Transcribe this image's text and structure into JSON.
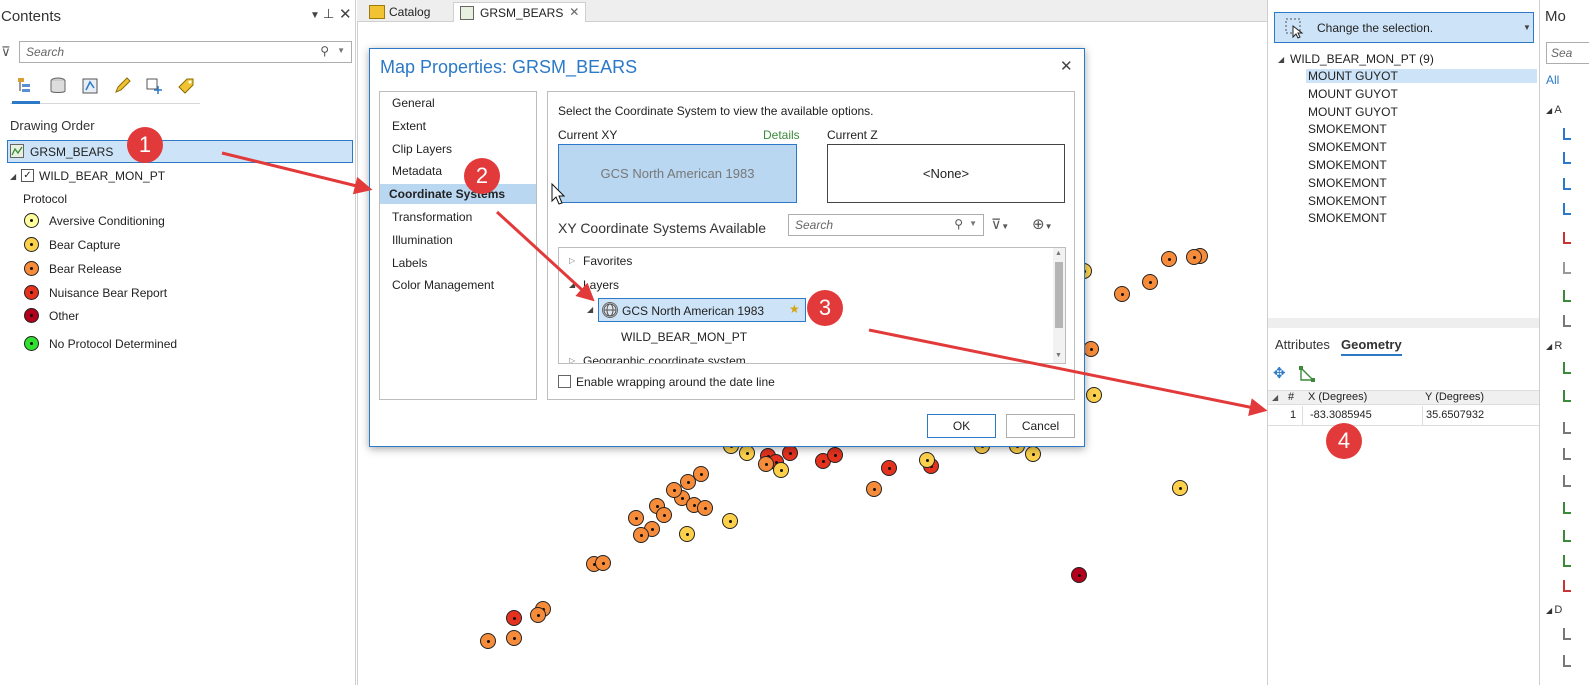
{
  "contents": {
    "title": "Contents",
    "search_placeholder": "Search",
    "section": "Drawing Order",
    "map_layer": "GRSM_BEARS",
    "feature_layer": "WILD_BEAR_MON_PT",
    "legend_heading": "Protocol",
    "legend": [
      {
        "label": "Aversive Conditioning",
        "color": "#ffff9e"
      },
      {
        "label": "Bear Capture",
        "color": "#fdd04c"
      },
      {
        "label": "Bear Release",
        "color": "#f68b3a"
      },
      {
        "label": "Nuisance Bear Report",
        "color": "#e5321e"
      },
      {
        "label": "Other",
        "color": "#b3001b"
      },
      {
        "label": "No Protocol Determined",
        "color": "#2fe02f"
      }
    ]
  },
  "tabs": {
    "catalog": "Catalog",
    "map": "GRSM_BEARS"
  },
  "dialog": {
    "title": "Map Properties: GRSM_BEARS",
    "nav": [
      "General",
      "Extent",
      "Clip Layers",
      "Metadata",
      "Coordinate Systems",
      "Transformation",
      "Illumination",
      "Labels",
      "Color Management"
    ],
    "instruction": "Select the Coordinate System to view the available options.",
    "current_xy_label": "Current XY",
    "details_link": "Details",
    "current_xy_value": "GCS North American 1983",
    "current_z_label": "Current Z",
    "current_z_value": "<None>",
    "available_heading": "XY Coordinate Systems Available",
    "search_placeholder": "Search",
    "tree": {
      "favorites": "Favorites",
      "layers": "Layers",
      "selected": "GCS North American 1983",
      "child": "WILD_BEAR_MON_PT",
      "geographic": "Geographic coordinate system"
    },
    "wrap_label": "Enable wrapping around the date line",
    "ok": "OK",
    "cancel": "Cancel"
  },
  "selection_panel": {
    "change_selection": "Change the selection.",
    "layer_name": "WILD_BEAR_MON_PT (9)",
    "features": [
      "MOUNT GUYOT",
      "MOUNT GUYOT",
      "MOUNT GUYOT",
      "SMOKEMONT",
      "SMOKEMONT",
      "SMOKEMONT",
      "SMOKEMONT",
      "SMOKEMONT",
      "SMOKEMONT"
    ],
    "tab_attributes": "Attributes",
    "tab_geometry": "Geometry",
    "col_num": "#",
    "col_x": "X (Degrees)",
    "col_y": "Y (Degrees)",
    "row_num": "1",
    "row_x": "-83.3085945",
    "row_y": "35.6507932"
  },
  "far_right": {
    "title": "Mo",
    "search": "Sea",
    "all": "All",
    "group_a": "A",
    "group_r": "R",
    "group_d": "D"
  },
  "badges": [
    "1",
    "2",
    "3",
    "4"
  ],
  "colors": {
    "accent": "#2b79c7",
    "selection": "#cde3f7",
    "arrow": "#e23a3a",
    "badge": "#e23a3a"
  }
}
